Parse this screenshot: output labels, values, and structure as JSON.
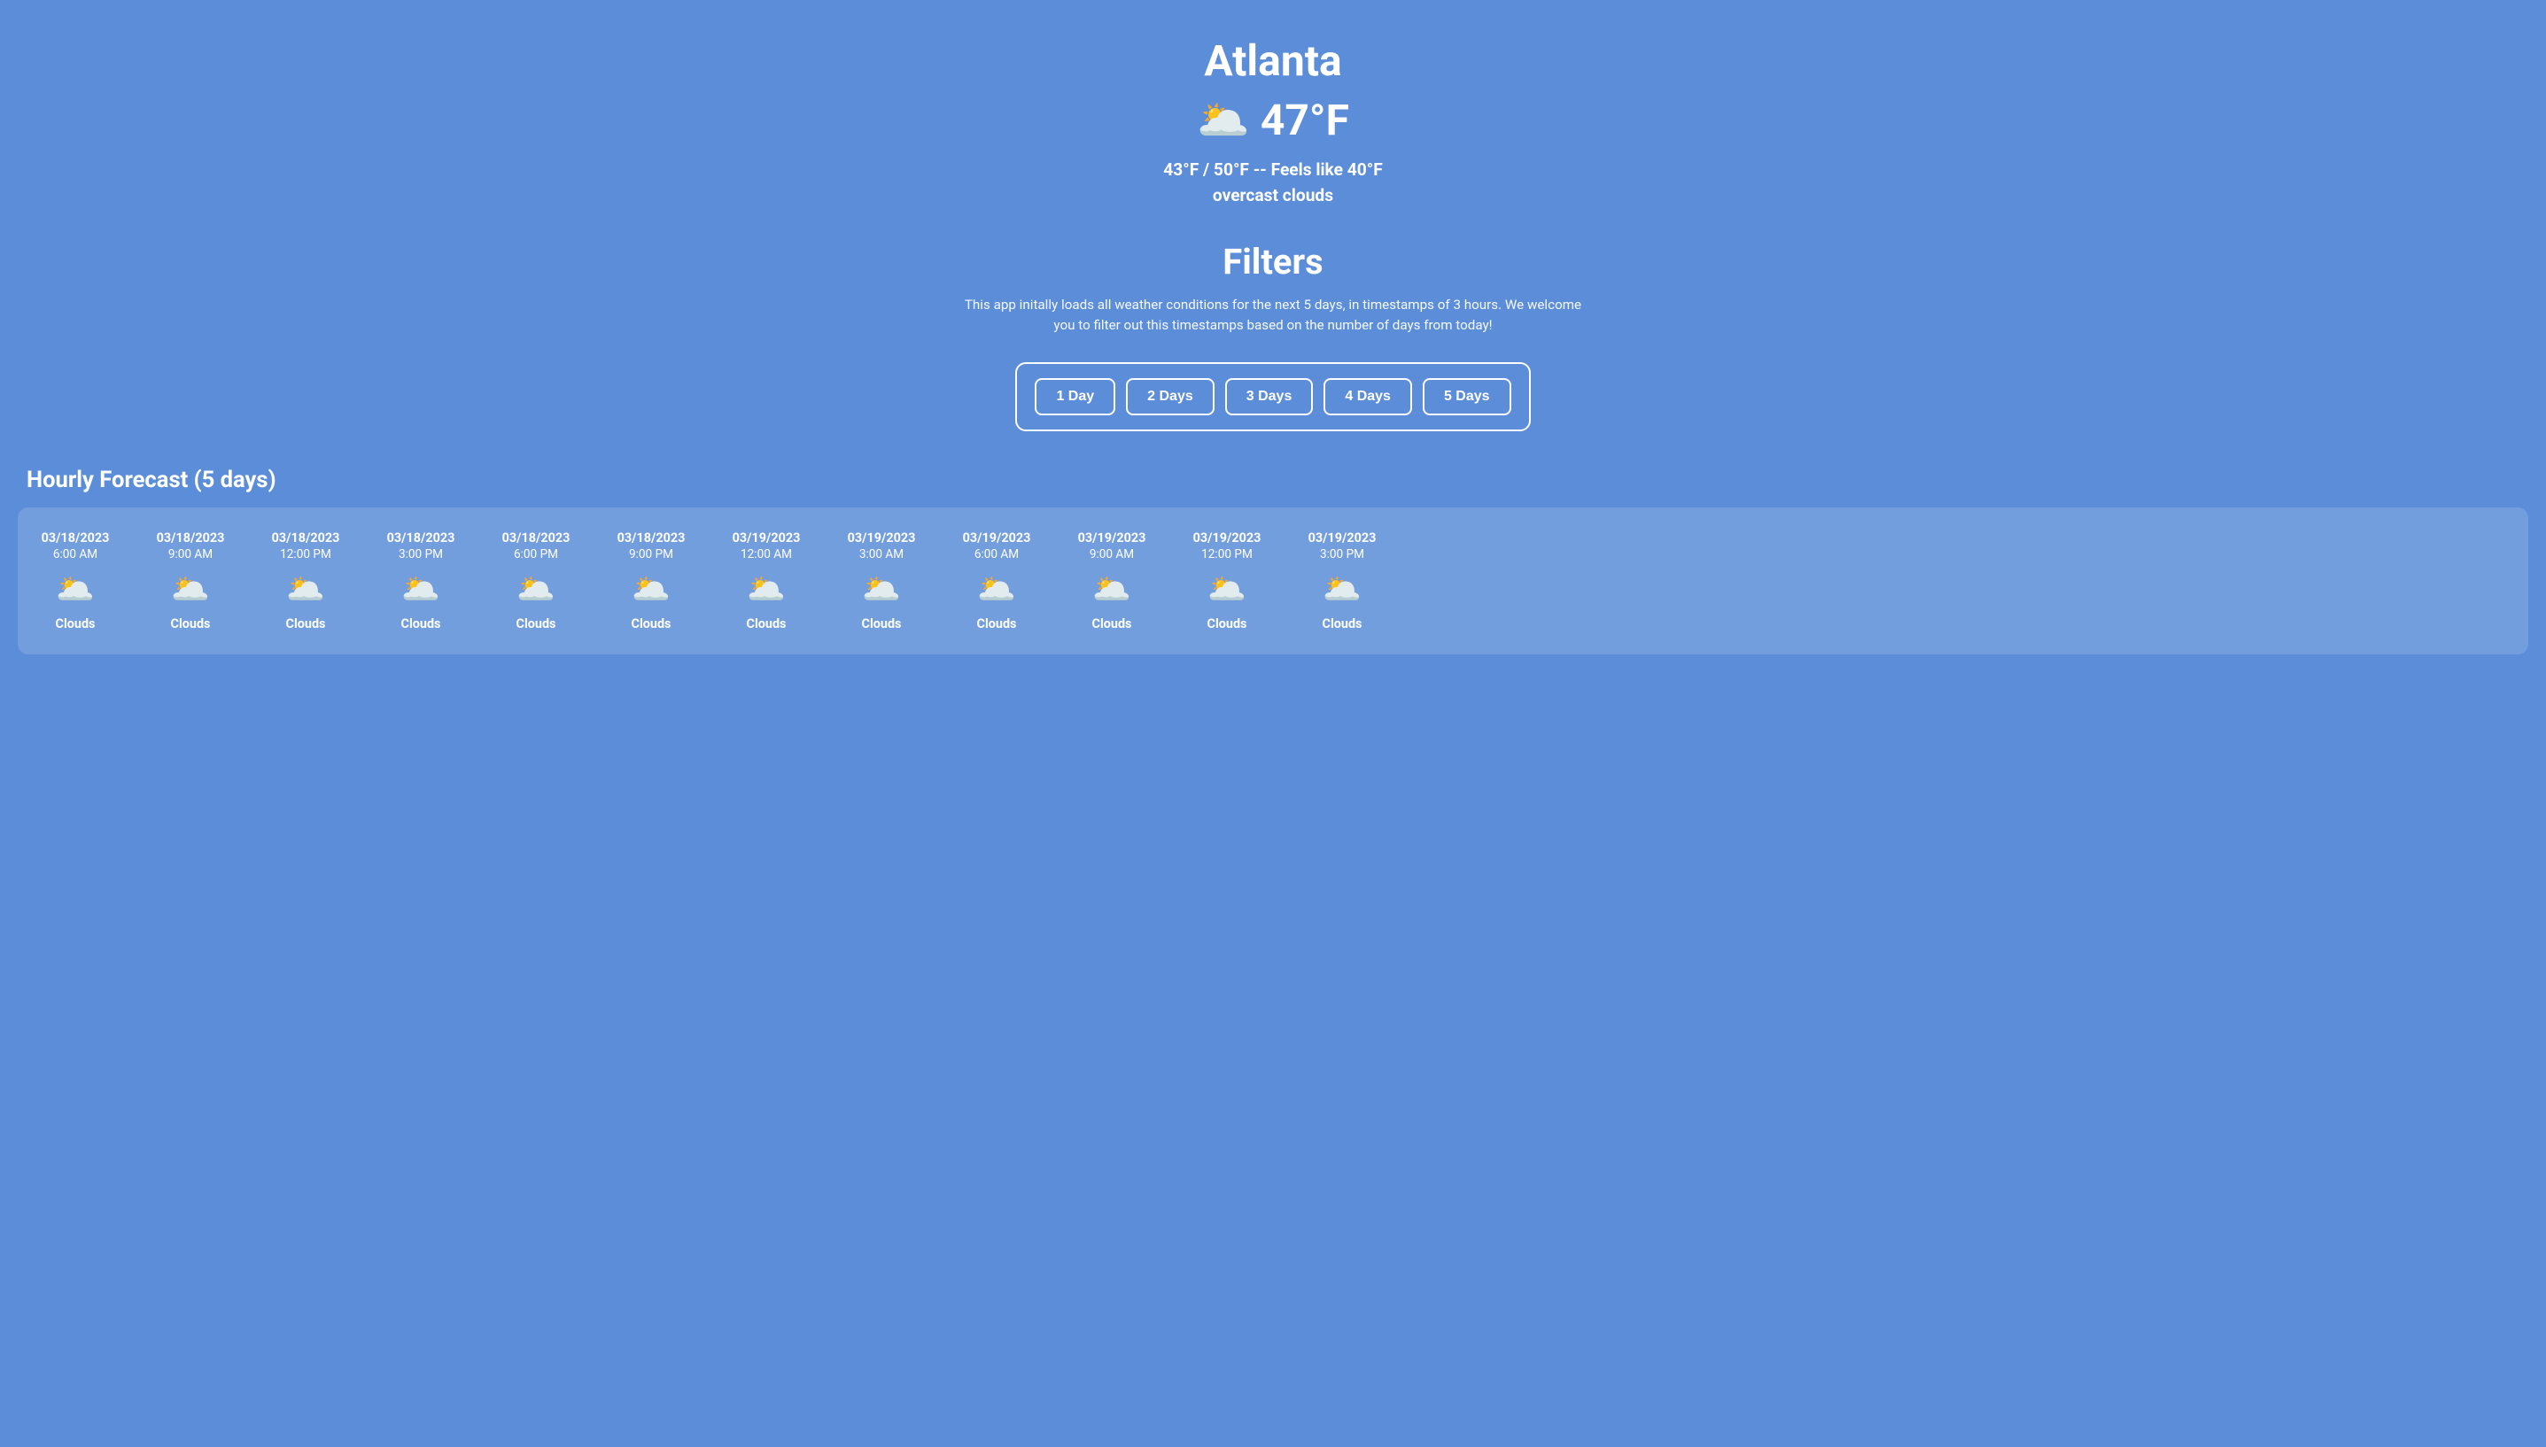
{
  "header": {
    "city": "Atlanta",
    "current_temp": "47°F",
    "weather_icon": "🌥️",
    "temp_range": "43°F / 50°F -- Feels like 40°F",
    "description": "overcast clouds"
  },
  "filters": {
    "title": "Filters",
    "description": "This app initally loads all weather conditions for the next 5 days, in timestamps of 3 hours. We welcome you to filter out this timestamps based on the number of days from today!",
    "buttons": [
      {
        "label": "1 Day",
        "value": 1
      },
      {
        "label": "2 Days",
        "value": 2
      },
      {
        "label": "3 Days",
        "value": 3
      },
      {
        "label": "4 Days",
        "value": 4
      },
      {
        "label": "5 Days",
        "value": 5
      }
    ]
  },
  "forecast": {
    "title": "Hourly Forecast (5 days)",
    "items": [
      {
        "date": "03/18/2023",
        "time": "6:00 AM",
        "icon": "🌥️",
        "condition": "Clouds"
      },
      {
        "date": "03/18/2023",
        "time": "9:00 AM",
        "icon": "🌥️",
        "condition": "Clouds"
      },
      {
        "date": "03/18/2023",
        "time": "12:00 PM",
        "icon": "🌥️",
        "condition": "Clouds"
      },
      {
        "date": "03/18/2023",
        "time": "3:00 PM",
        "icon": "🌥️",
        "condition": "Clouds"
      },
      {
        "date": "03/18/2023",
        "time": "6:00 PM",
        "icon": "🌥️",
        "condition": "Clouds"
      },
      {
        "date": "03/18/2023",
        "time": "9:00 PM",
        "icon": "🌥️",
        "condition": "Clouds"
      },
      {
        "date": "03/19/2023",
        "time": "12:00 AM",
        "icon": "🌥️",
        "condition": "Clouds"
      },
      {
        "date": "03/19/2023",
        "time": "3:00 AM",
        "icon": "🌥️",
        "condition": "Clouds"
      },
      {
        "date": "03/19/2023",
        "time": "6:00 AM",
        "icon": "🌥️",
        "condition": "Clouds"
      },
      {
        "date": "03/19/2023",
        "time": "9:00 AM",
        "icon": "🌥️",
        "condition": "Clouds"
      },
      {
        "date": "03/19/2023",
        "time": "12:00 PM",
        "icon": "🌥️",
        "condition": "Clouds"
      },
      {
        "date": "03/19/2023",
        "time": "3:00 PM",
        "icon": "🌥️",
        "condition": "Clouds"
      }
    ]
  }
}
